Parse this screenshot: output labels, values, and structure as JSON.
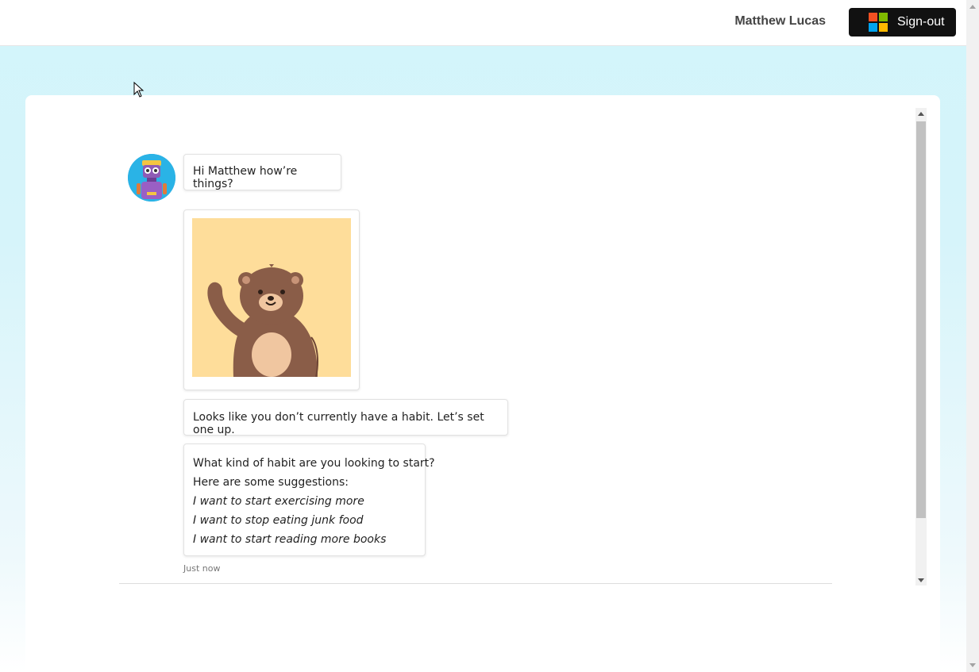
{
  "header": {
    "user_name": "Matthew Lucas",
    "signout_label": "Sign-out",
    "logo_colors": [
      "#f25022",
      "#7fba00",
      "#00a4ef",
      "#ffb900"
    ]
  },
  "chat": {
    "messages": [
      {
        "type": "text",
        "text": "Hi Matthew how’re things?"
      },
      {
        "type": "image",
        "image": "waving-bear"
      },
      {
        "type": "text",
        "text": "Looks like you don’t currently have a habit. Let’s set one up."
      },
      {
        "type": "text",
        "lines": [
          "What kind of habit are you looking to start?",
          "Here are some suggestions:"
        ],
        "suggestions": [
          "I want to start exercising more",
          "I want to stop eating junk food",
          "I want to start reading more books"
        ]
      }
    ],
    "timestamp": "Just now"
  },
  "colors": {
    "background": "#d2f5fb",
    "signout_bg": "#111111",
    "avatar_bg": "#2aa7e0",
    "image_bg": "#fedd9a",
    "bear": "#8a5d48"
  }
}
